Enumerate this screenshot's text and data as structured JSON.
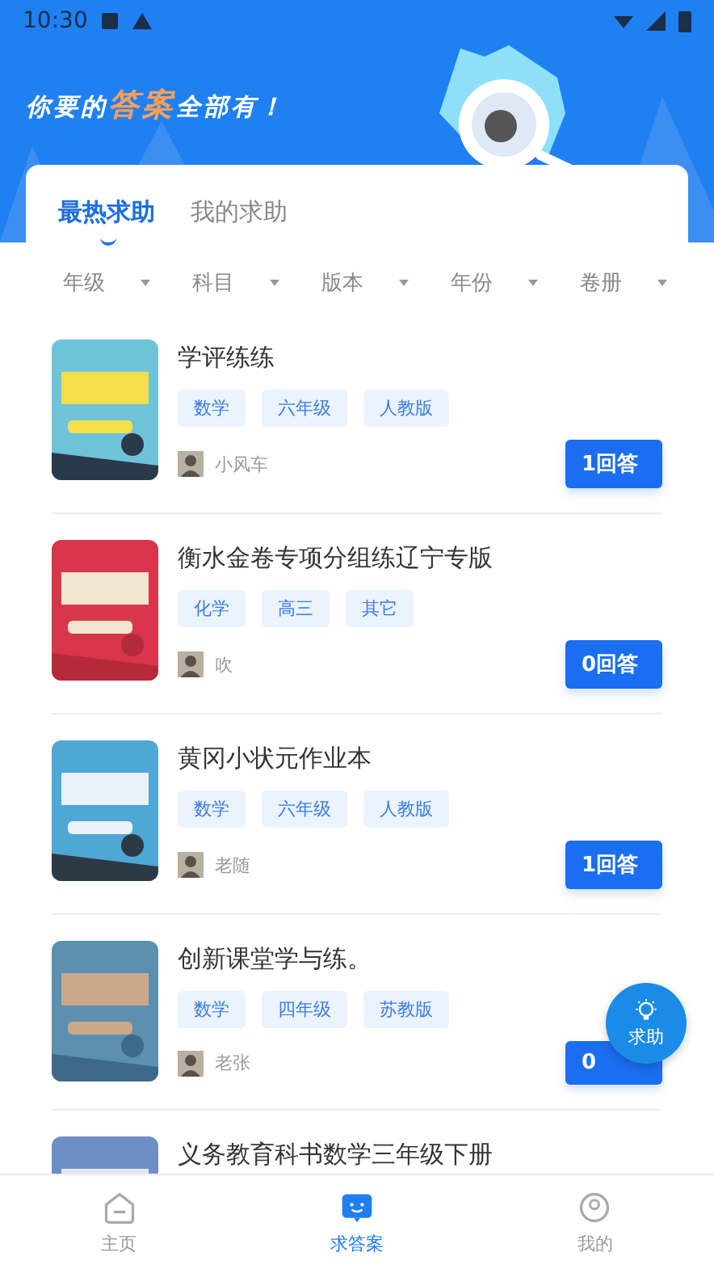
{
  "status_bar": {
    "time": "10:30"
  },
  "slogan": {
    "before": "你要的",
    "highlight": "答案",
    "after": "全部有！"
  },
  "tabs": [
    {
      "label": "最热求助",
      "selected": true
    },
    {
      "label": "我的求助",
      "selected": false
    }
  ],
  "filters": [
    "年级",
    "科目",
    "版本",
    "年份",
    "卷册"
  ],
  "questions": [
    {
      "title": "学评练练",
      "tags": [
        "数学",
        "六年级",
        "人教版"
      ],
      "user": "小风车",
      "answers": "1回答"
    },
    {
      "title": "衡水金卷专项分组练辽宁专版",
      "tags": [
        "化学",
        "高三",
        "其它"
      ],
      "user": "吹",
      "answers": "0回答"
    },
    {
      "title": "黄冈小状元作业本",
      "tags": [
        "数学",
        "六年级",
        "人教版"
      ],
      "user": "老随",
      "answers": "1回答"
    },
    {
      "title": "创新课堂学与练。",
      "tags": [
        "数学",
        "四年级",
        "苏教版"
      ],
      "user": "老张",
      "answers": "0"
    },
    {
      "title": "义务教育科书数学三年级下册"
    }
  ],
  "help_button": {
    "label": "求助"
  },
  "bottom_nav": [
    {
      "label": "主页",
      "kind": "home",
      "selected": false
    },
    {
      "label": "求答案",
      "kind": "chat",
      "selected": true
    },
    {
      "label": "我的",
      "kind": "profile",
      "selected": false
    }
  ]
}
